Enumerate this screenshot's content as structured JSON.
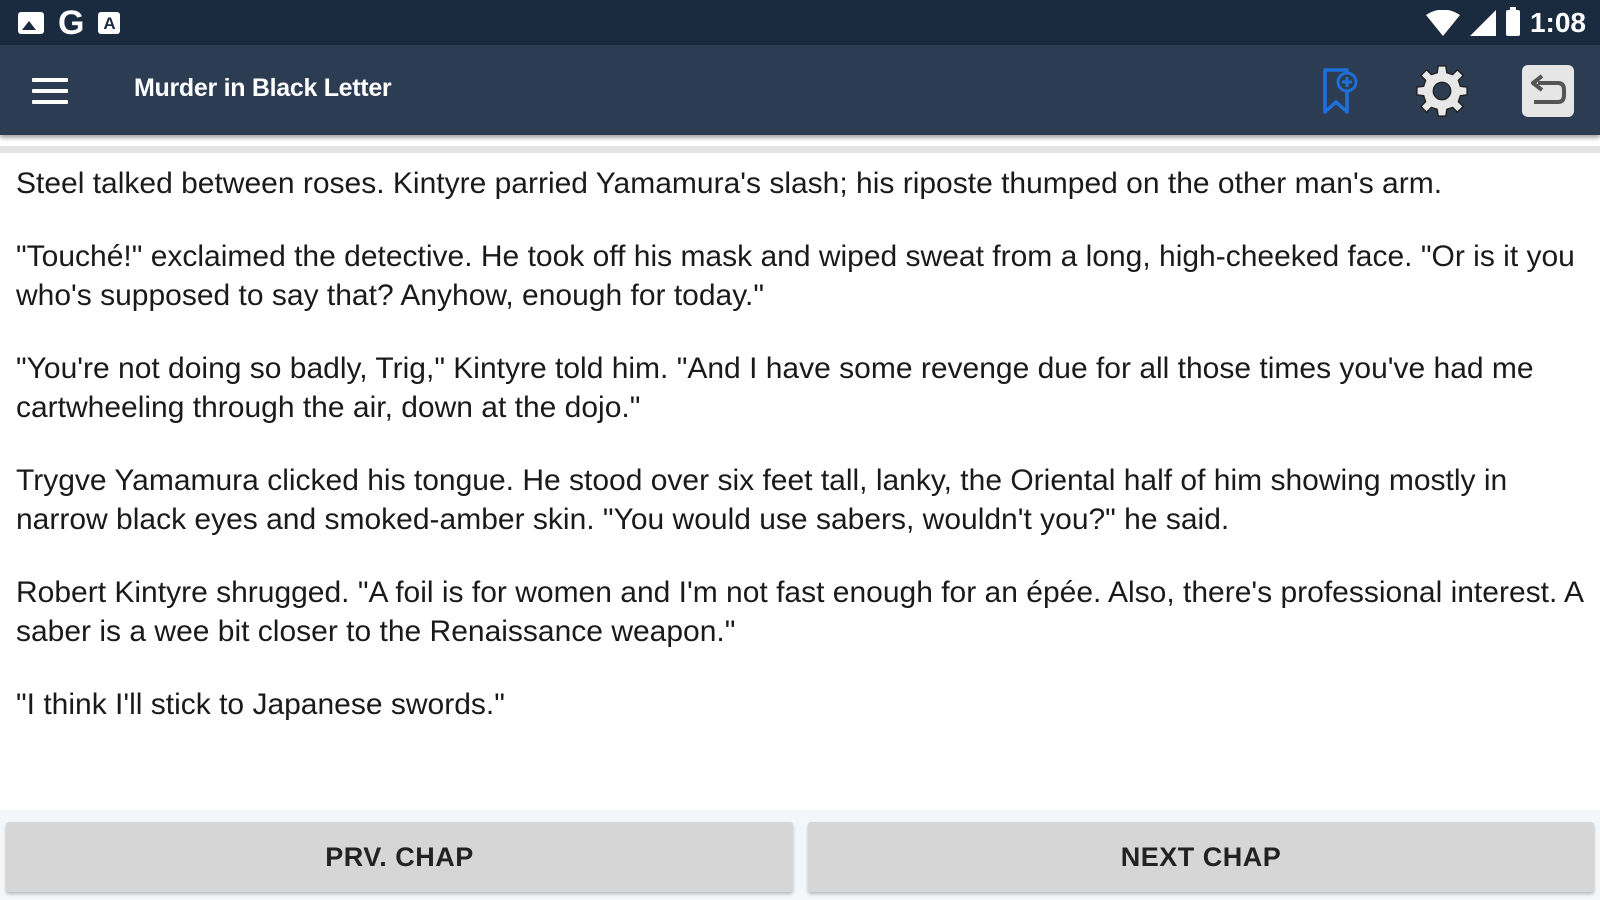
{
  "status_bar": {
    "time": "1:08",
    "left_icons": [
      "image-icon",
      "google-icon",
      "font-icon"
    ],
    "google_letter": "G",
    "a_letter": "A",
    "right_icons": [
      "wifi-icon",
      "signal-icon",
      "battery-icon"
    ]
  },
  "toolbar": {
    "title": "Murder in Black Letter",
    "menu_icon": "hamburger-menu-icon",
    "bookmark_icon": "bookmark-add-icon",
    "settings_icon": "gear-icon",
    "back_icon": "return-icon",
    "accent_color": "#1e6fd9"
  },
  "content": {
    "paragraphs": [
      "Steel talked between roses. Kintyre parried Yamamura's slash; his riposte thumped on the other man's arm.",
      "\"Touché!\" exclaimed the detective. He took off his mask and wiped sweat from a long, high-cheeked face. \"Or is it you who's supposed to say that? Anyhow, enough for today.\"",
      "\"You're not doing so badly, Trig,\" Kintyre told him. \"And I have some revenge due for all those times you've had me cartwheeling through the air, down at the dojo.\"",
      "Trygve Yamamura clicked his tongue. He stood over six feet tall, lanky, the Oriental half of him showing mostly in narrow black eyes and smoked-amber skin. \"You would use sabers, wouldn't you?\" he said.",
      "Robert Kintyre shrugged. \"A foil is for women and I'm not fast enough for an épée. Also, there's professional interest. A saber is a wee bit closer to the Renaissance weapon.\"",
      "\"I think I'll stick to Japanese swords.\""
    ]
  },
  "navigation": {
    "prev_label": "PRV. CHAP",
    "next_label": "NEXT CHAP"
  },
  "colors": {
    "status_bar": "#1a2a3f",
    "toolbar": "#2c3c52",
    "button": "#d6d6d6"
  }
}
